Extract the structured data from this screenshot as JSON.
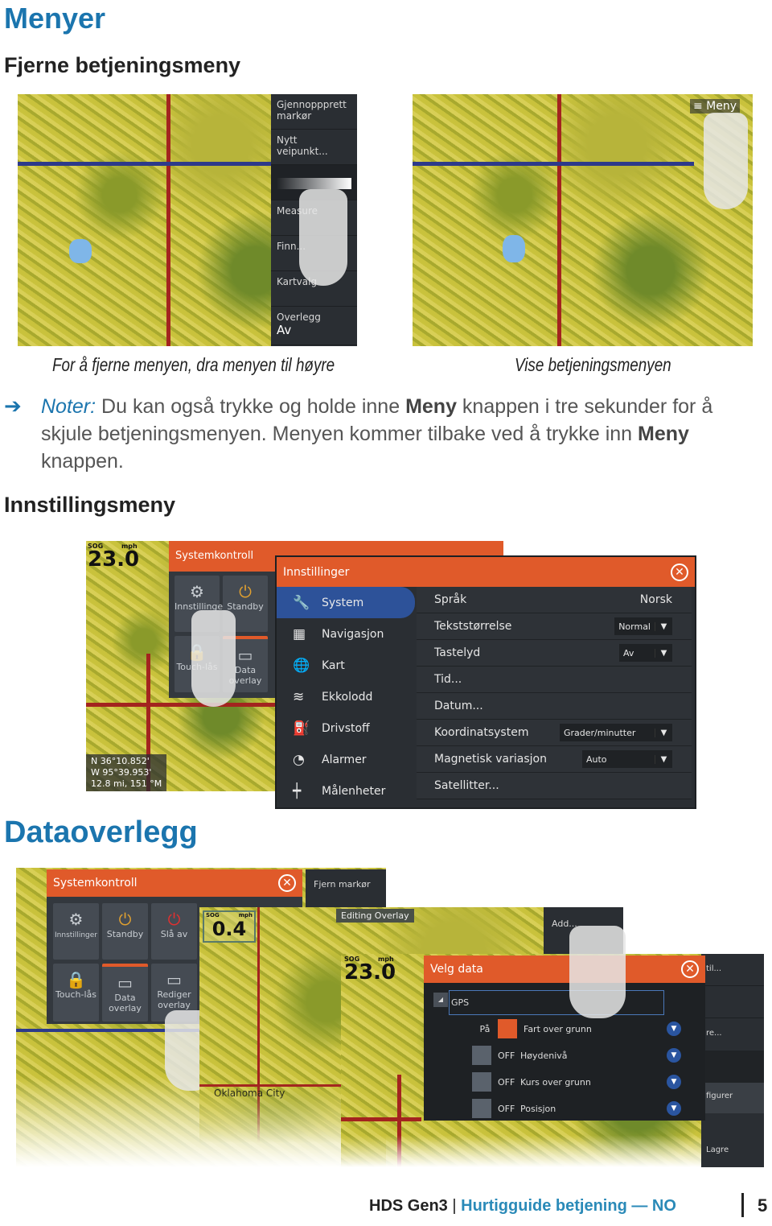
{
  "title": "Menyer",
  "section1": {
    "heading": "Fjerne betjeningsmeny",
    "menu_items": [
      "Gjennoppprett markør",
      "Nytt veipunkt...",
      "Measure",
      "Finn...",
      "Kartvalg"
    ],
    "overlay_label": "Overlegg",
    "overlay_value": "Av",
    "meny_button": "Meny",
    "caption_left": "For å fjerne menyen, dra menyen til høyre",
    "caption_right": "Vise betjeningsmenyen"
  },
  "note": {
    "label": "Noter:",
    "text1": "Du kan også trykke og holde inne ",
    "bold1": "Meny",
    "text2": " knappen i tre sekunder for å skjule betjeningsmenyen. Menyen kommer tilbake ved å trykke inn ",
    "bold2": "Meny",
    "text3": " knappen."
  },
  "section2": {
    "heading": "Innstillingsmeny",
    "sog": {
      "label": "SOG",
      "unit": "mph",
      "value": "23.0"
    },
    "position": [
      "N  36°10.852'",
      "W  95°39.953'",
      "12.8 mi, 151 °M"
    ],
    "systemkontroll": {
      "title": "Systemkontroll",
      "tiles": [
        "Innstillinger",
        "Standby",
        "Touch-lås",
        "Data overlay"
      ]
    },
    "settings": {
      "title": "Innstillinger",
      "categories": [
        "System",
        "Navigasjon",
        "Kart",
        "Ekkolodd",
        "Drivstoff",
        "Alarmer",
        "Målenheter"
      ],
      "rows": [
        {
          "label": "Språk",
          "value": "Norsk"
        },
        {
          "label": "Tekststørrelse",
          "select": "Normal"
        },
        {
          "label": "Tastelyd",
          "select": "Av"
        },
        {
          "label": "Tid..."
        },
        {
          "label": "Datum..."
        },
        {
          "label": "Koordinatsystem",
          "select": "Grader/minutter"
        },
        {
          "label": "Magnetisk variasjon",
          "select": "Auto"
        },
        {
          "label": "Satellitter..."
        }
      ]
    }
  },
  "section3": {
    "heading": "Dataoverlegg",
    "systemkontroll": {
      "title": "Systemkontroll",
      "tiles": [
        "Innstillinger",
        "Standby",
        "Slå av",
        "Touch-lås",
        "Data overlay",
        "Rediger overlay"
      ]
    },
    "fjern": "Fjern markør",
    "editing": "Editing Overlay",
    "sog_small": {
      "label": "SOG",
      "unit": "mph",
      "value": "0.4"
    },
    "sog_big": {
      "label": "SOG",
      "unit": "mph",
      "value": "23.0"
    },
    "city": "Oklahoma City",
    "add": "Add...",
    "right_menu": [
      "til...",
      "re...",
      "figurer",
      "Lagre"
    ],
    "velg": {
      "title": "Velg data",
      "group": "GPS",
      "rows": [
        {
          "state": "På",
          "label": "Fart over grunn",
          "on": true
        },
        {
          "state": "OFF",
          "label": "Høydenivå",
          "on": false
        },
        {
          "state": "OFF",
          "label": "Kurs over grunn",
          "on": false
        },
        {
          "state": "OFF",
          "label": "Posisjon",
          "on": false
        }
      ]
    }
  },
  "footer": {
    "product": "HDS Gen3",
    "guide": "Hurtigguide betjening",
    "lang": "— NO",
    "page": "5"
  },
  "colors": {
    "heading_blue": "#1b75ae",
    "orange": "#e05a2a",
    "panel": "#2a2e33",
    "select_blue": "#2a55a0"
  }
}
